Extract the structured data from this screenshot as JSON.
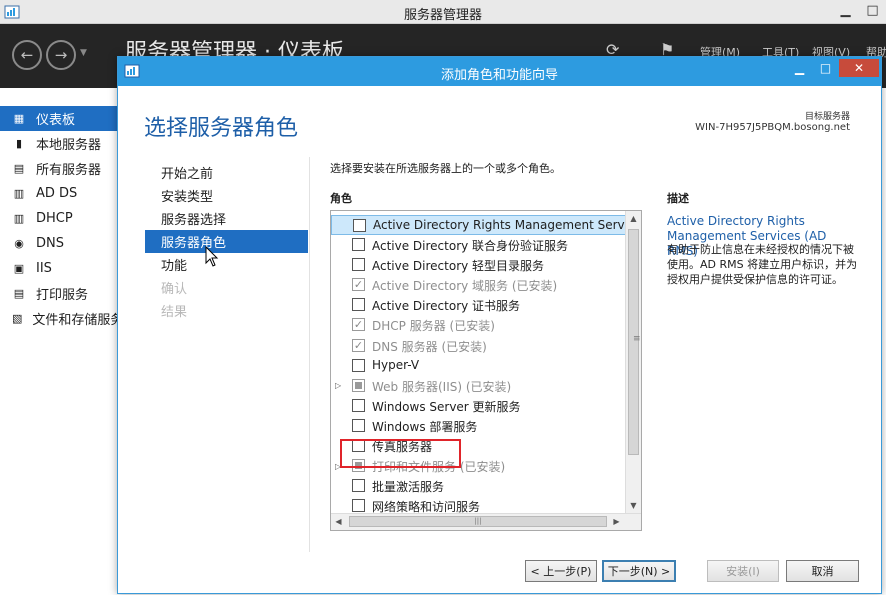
{
  "outer_window": {
    "title": "服务器管理器",
    "heading": "服务器管理器 · 仪表板",
    "toolbar": [
      "管理(M)",
      "工具(T)",
      "视图(V)",
      "帮助(H)"
    ],
    "controls": {
      "minimize": "▁",
      "maximize": "□"
    }
  },
  "sidebar": {
    "items": [
      {
        "label": "仪表板",
        "icon": "dashboard-icon"
      },
      {
        "label": "本地服务器",
        "icon": "server-icon"
      },
      {
        "label": "所有服务器",
        "icon": "servers-icon"
      },
      {
        "label": "AD DS",
        "icon": "ad-ds-icon"
      },
      {
        "label": "DHCP",
        "icon": "dhcp-icon"
      },
      {
        "label": "DNS",
        "icon": "dns-icon"
      },
      {
        "label": "IIS",
        "icon": "iis-icon"
      },
      {
        "label": "打印服务",
        "icon": "printer-icon"
      },
      {
        "label": "文件和存储服务",
        "icon": "storage-icon"
      }
    ]
  },
  "dialog": {
    "title": "添加角色和功能向导",
    "heading": "选择服务器角色",
    "destination_label": "目标服务器",
    "destination_value": "WIN-7H957J5PBQM.bosong.net",
    "controls": {
      "minimize": "▁",
      "maximize": "□",
      "close": "✕"
    },
    "steps": [
      {
        "label": "开始之前",
        "state": "normal"
      },
      {
        "label": "安装类型",
        "state": "normal"
      },
      {
        "label": "服务器选择",
        "state": "normal"
      },
      {
        "label": "服务器角色",
        "state": "active"
      },
      {
        "label": "功能",
        "state": "normal"
      },
      {
        "label": "确认",
        "state": "disabled"
      },
      {
        "label": "结果",
        "state": "disabled"
      }
    ],
    "instruction": "选择要安装在所选服务器上的一个或多个角色。",
    "roles_label": "角色",
    "description_label": "描述",
    "roles": [
      {
        "label": "Active Directory Rights Management Services",
        "checked": false,
        "disabled": false,
        "expandable": false,
        "selected": true
      },
      {
        "label": "Active Directory 联合身份验证服务",
        "checked": false,
        "disabled": false,
        "expandable": false,
        "selected": false
      },
      {
        "label": "Active Directory 轻型目录服务",
        "checked": false,
        "disabled": false,
        "expandable": false,
        "selected": false
      },
      {
        "label": "Active Directory 域服务 (已安装)",
        "checked": true,
        "disabled": true,
        "expandable": false,
        "selected": false
      },
      {
        "label": "Active Directory 证书服务",
        "checked": false,
        "disabled": false,
        "expandable": false,
        "selected": false
      },
      {
        "label": "DHCP 服务器 (已安装)",
        "checked": true,
        "disabled": true,
        "expandable": false,
        "selected": false
      },
      {
        "label": "DNS 服务器 (已安装)",
        "checked": true,
        "disabled": true,
        "expandable": false,
        "selected": false
      },
      {
        "label": "Hyper-V",
        "checked": false,
        "disabled": false,
        "expandable": false,
        "selected": false
      },
      {
        "label": "Web 服务器(IIS) (已安装)",
        "checked": "partial",
        "disabled": true,
        "expandable": true,
        "selected": false
      },
      {
        "label": "Windows Server 更新服务",
        "checked": false,
        "disabled": false,
        "expandable": false,
        "selected": false
      },
      {
        "label": "Windows 部署服务",
        "checked": false,
        "disabled": false,
        "expandable": false,
        "selected": false
      },
      {
        "label": "传真服务器",
        "checked": false,
        "disabled": false,
        "expandable": false,
        "selected": false
      },
      {
        "label": "打印和文件服务 (已安装)",
        "checked": "partial",
        "disabled": true,
        "expandable": true,
        "selected": false
      },
      {
        "label": "批量激活服务",
        "checked": false,
        "disabled": false,
        "expandable": false,
        "selected": false
      },
      {
        "label": "网络策略和访问服务",
        "checked": false,
        "disabled": false,
        "expandable": false,
        "selected": false
      }
    ],
    "description_title": "Active Directory Rights Management Services (AD RMS)",
    "description_body": "有助于防止信息在未经授权的情况下被使用。AD RMS 将建立用户标识，并为授权用户提供受保护信息的许可证。",
    "buttons": {
      "previous": "< 上一步(P)",
      "next": "下一步(N) >",
      "install": "安装(I)",
      "cancel": "取消"
    }
  },
  "colors": {
    "accent": "#2d9be0",
    "selection": "#1f6ec2",
    "heading": "#1e5fa8",
    "header_dark": "#252525",
    "highlight_box": "#e0242a"
  }
}
